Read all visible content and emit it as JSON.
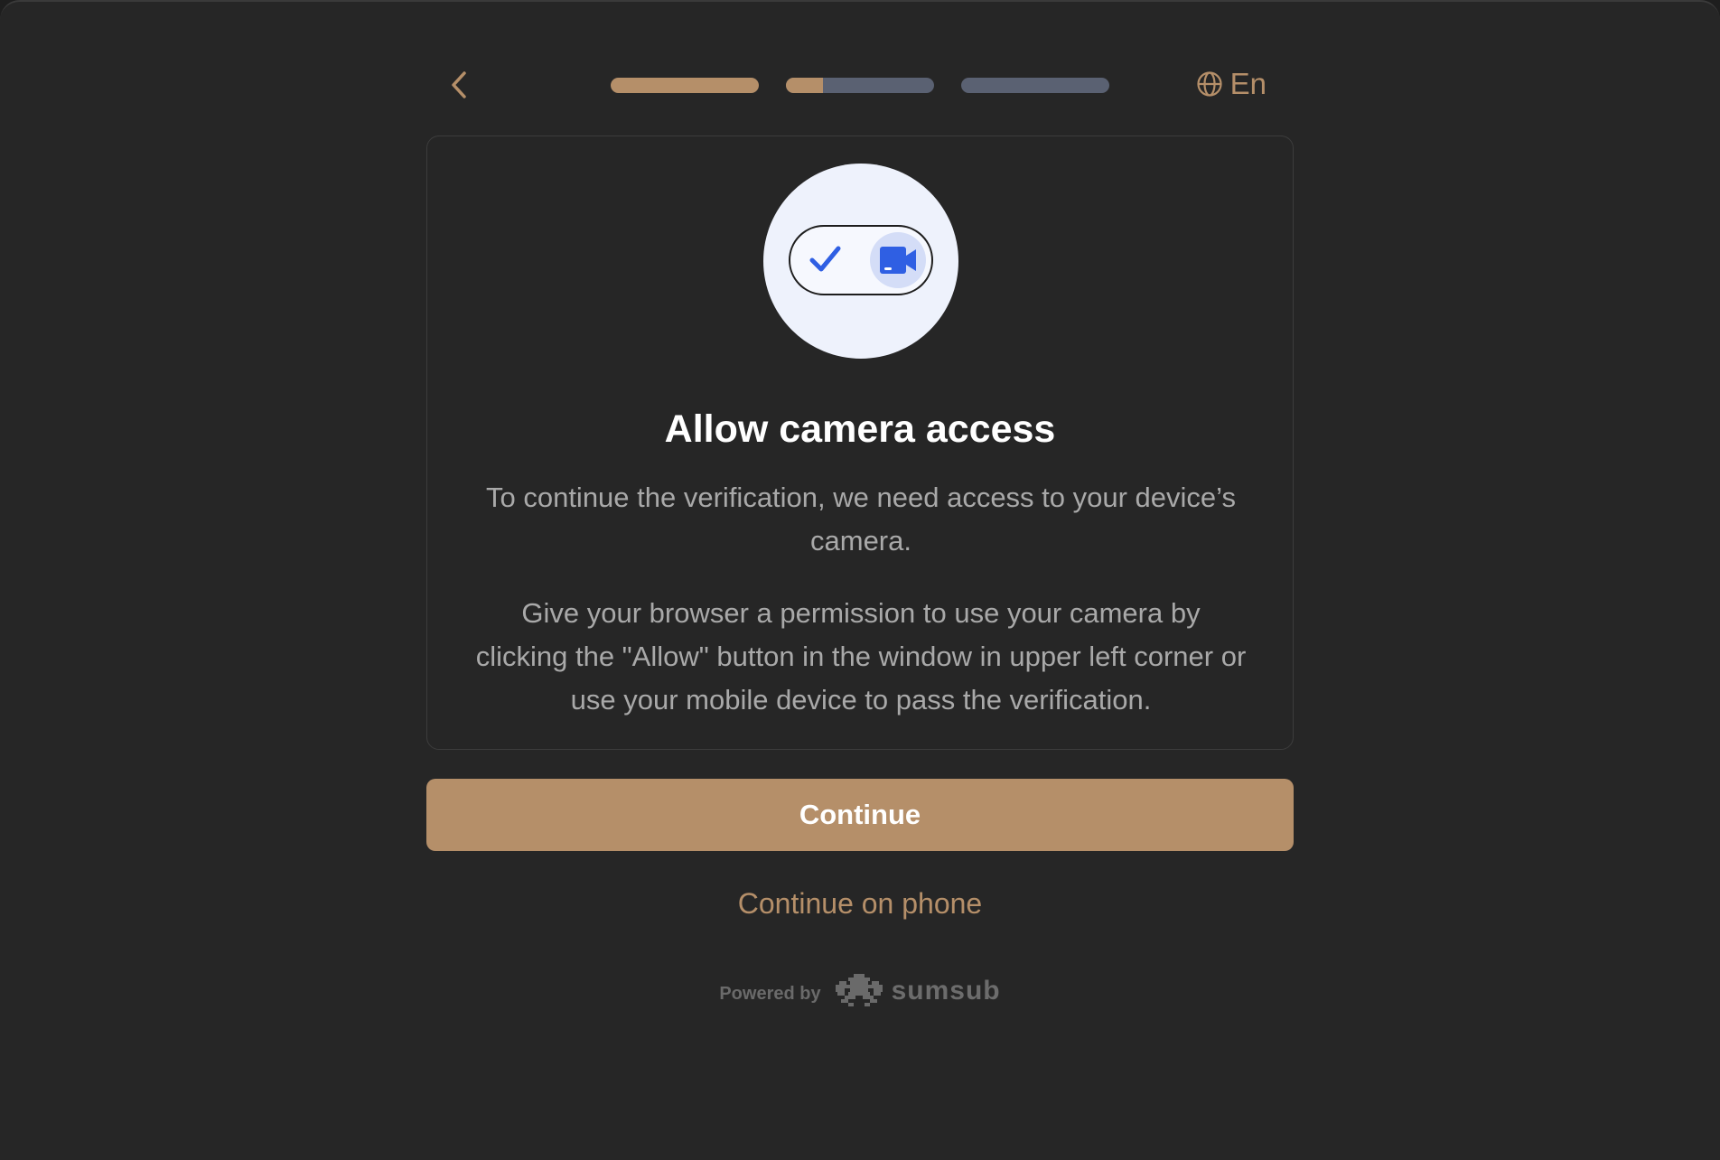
{
  "header": {
    "back_icon": "chevron-left-icon",
    "steps": [
      {
        "progress": 1.0
      },
      {
        "progress": 0.25
      },
      {
        "progress": 0.0
      }
    ],
    "language_icon": "globe-icon",
    "language_label": "En"
  },
  "card": {
    "illustration_icons": [
      "checkmark-icon",
      "video-camera-icon"
    ],
    "title": "Allow camera access",
    "paragraph1": "To continue the verification, we need access to your device’s camera.",
    "paragraph2": "Give your browser a permission to use your camera by clicking the \"Allow\" button in the window in upper left corner or use your mobile device to pass the verification."
  },
  "actions": {
    "continue_label": "Continue",
    "continue_on_phone_label": "Continue on phone"
  },
  "footer": {
    "powered_by": "Powered by",
    "brand": "sumsub"
  },
  "colors": {
    "accent": "#b58f69",
    "background": "#262626",
    "progress_track": "#5a6172",
    "icon_blue": "#2f5fe3"
  }
}
